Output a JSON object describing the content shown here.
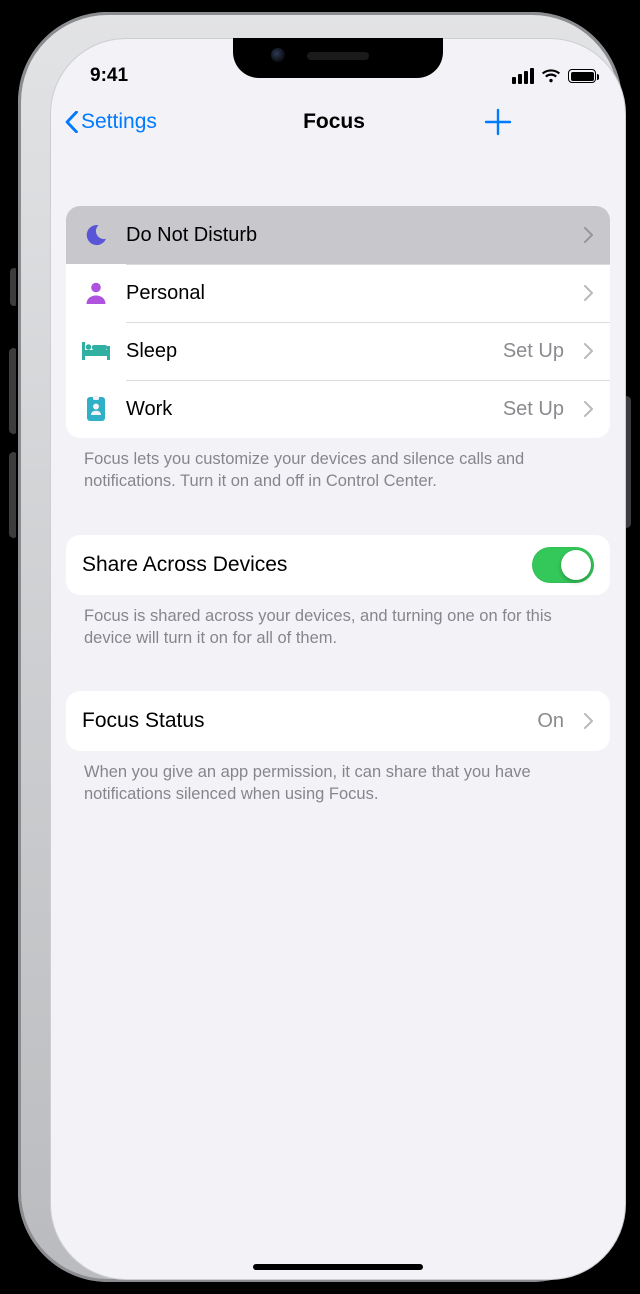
{
  "status": {
    "time": "9:41"
  },
  "nav": {
    "back_label": "Settings",
    "title": "Focus"
  },
  "focus_modes": {
    "items": [
      {
        "label": "Do Not Disturb",
        "detail": "",
        "icon": "moon",
        "color": "#5856d6",
        "selected": true
      },
      {
        "label": "Personal",
        "detail": "",
        "icon": "person",
        "color": "#af52de",
        "selected": false
      },
      {
        "label": "Sleep",
        "detail": "Set Up",
        "icon": "bed",
        "color": "#30b0a0",
        "selected": false
      },
      {
        "label": "Work",
        "detail": "Set Up",
        "icon": "badge",
        "color": "#30b0c6",
        "selected": false
      }
    ],
    "footer": "Focus lets you customize your devices and silence calls and notifications. Turn it on and off in Control Center."
  },
  "share": {
    "label": "Share Across Devices",
    "on": true,
    "footer": "Focus is shared across your devices, and turning one on for this device will turn it on for all of them."
  },
  "focus_status": {
    "label": "Focus Status",
    "detail": "On",
    "footer": "When you give an app permission, it can share that you have notifications silenced when using Focus."
  }
}
